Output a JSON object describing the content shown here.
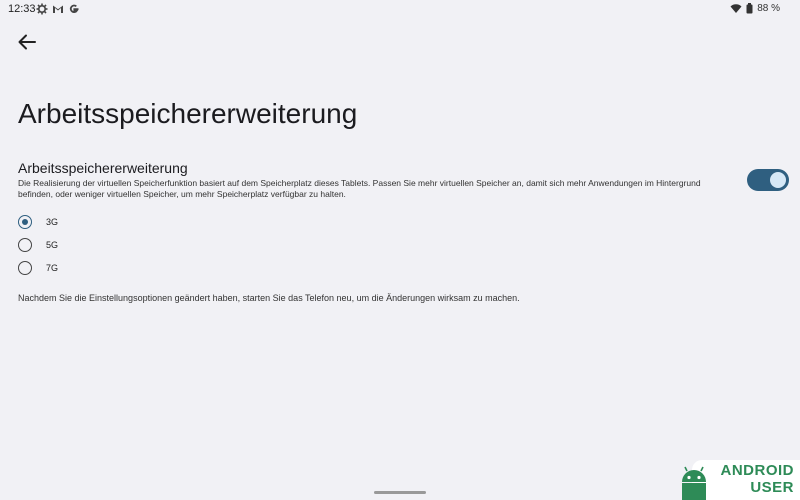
{
  "status_bar": {
    "time": "12:33",
    "icons_left": [
      "gear-icon",
      "gmail-icon",
      "google-icon"
    ],
    "icons_right": [
      "wifi-icon",
      "battery-icon"
    ],
    "battery": "88 %"
  },
  "header": {
    "back_icon": "arrow-left-icon",
    "page_title": "Arbeitsspeichererweiterung"
  },
  "setting": {
    "title": "Arbeitsspeichererweiterung",
    "description": "Die Realisierung der virtuellen Speicherfunktion basiert auf dem Speicherplatz dieses Tablets. Passen Sie mehr virtuellen Speicher an, damit sich mehr Anwendungen im Hintergrund befinden, oder weniger virtuellen Speicher, um mehr Speicherplatz verfügbar zu halten.",
    "toggle_on": true
  },
  "options": [
    {
      "label": "3G",
      "selected": true
    },
    {
      "label": "5G",
      "selected": false
    },
    {
      "label": "7G",
      "selected": false
    }
  ],
  "note": "Nachdem Sie die Einstellungsoptionen geändert haben, starten Sie das Telefon neu, um die Änderungen wirksam zu machen.",
  "watermark": {
    "line1": "ANDROID",
    "line2": "USER"
  },
  "colors": {
    "accent": "#2f5f80",
    "background": "#f1f1f5",
    "watermark": "#2e8b57"
  }
}
